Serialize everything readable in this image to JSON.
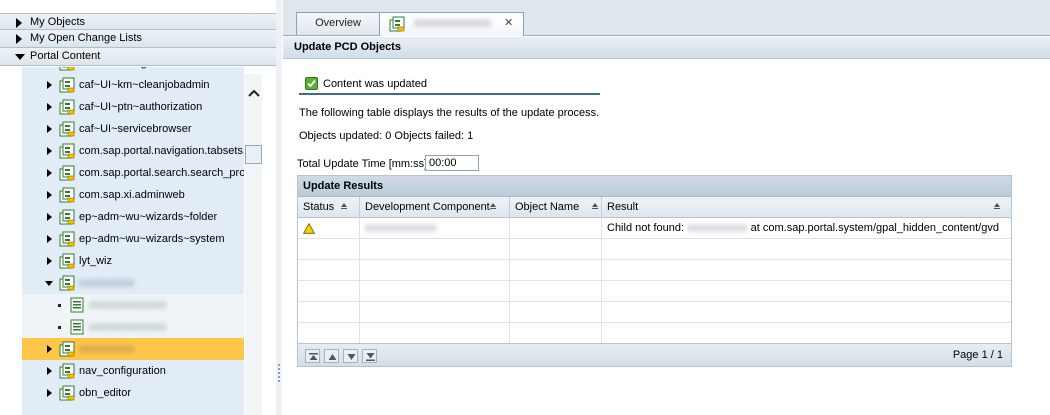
{
  "nav": {
    "sections": [
      {
        "label": "My Objects",
        "expanded": false
      },
      {
        "label": "My Open Change Lists",
        "expanded": false
      },
      {
        "label": "Portal Content",
        "expanded": true
      }
    ],
    "tree": [
      {
        "label": "caf~UI~configuration",
        "level": 0,
        "expanded": false,
        "kind": "package",
        "partial": true
      },
      {
        "label": "caf~UI~km~cleanjobadmin",
        "level": 0,
        "expanded": false,
        "kind": "package"
      },
      {
        "label": "caf~UI~ptn~authorization",
        "level": 0,
        "expanded": false,
        "kind": "package"
      },
      {
        "label": "caf~UI~servicebrowser",
        "level": 0,
        "expanded": false,
        "kind": "package"
      },
      {
        "label": "com.sap.portal.navigation.tabsets.",
        "level": 0,
        "expanded": false,
        "kind": "package"
      },
      {
        "label": "com.sap.portal.search.search_pro",
        "level": 0,
        "expanded": false,
        "kind": "package"
      },
      {
        "label": "com.sap.xi.adminweb",
        "level": 0,
        "expanded": false,
        "kind": "package"
      },
      {
        "label": "ep~adm~wu~wizards~folder",
        "level": 0,
        "expanded": false,
        "kind": "package"
      },
      {
        "label": "ep~adm~wu~wizards~system",
        "level": 0,
        "expanded": false,
        "kind": "package"
      },
      {
        "label": "lyt_wiz",
        "level": 0,
        "expanded": false,
        "kind": "package"
      },
      {
        "label": "",
        "level": 0,
        "expanded": true,
        "kind": "package",
        "redacted": true
      },
      {
        "label": "",
        "level": 1,
        "kind": "object",
        "redacted": true
      },
      {
        "label": "",
        "level": 1,
        "kind": "object",
        "redacted": true
      },
      {
        "label": "",
        "level": 0,
        "expanded": false,
        "kind": "package",
        "redacted": true,
        "selected": true
      },
      {
        "label": "nav_configuration",
        "level": 0,
        "expanded": false,
        "kind": "package"
      },
      {
        "label": "obn_editor",
        "level": 0,
        "expanded": false,
        "kind": "package"
      }
    ]
  },
  "tabs": {
    "overview": "Overview",
    "active_close": "✕"
  },
  "panel": {
    "title": "Update PCD Objects",
    "message": "Content was updated",
    "description": "The following table displays the results of the update process.",
    "summary": "Objects updated: 0 Objects failed: 1",
    "time_label": "Total Update Time [mm:ss]",
    "time_value": "00:00"
  },
  "table": {
    "title": "Update Results",
    "columns": [
      "Status",
      "Development Component",
      "Object Name",
      "Result"
    ],
    "rows": [
      {
        "status": "warning",
        "component": "",
        "component_redacted": true,
        "object": "",
        "result_prefix": "Child not found: ",
        "result_suffix": " at com.sap.portal.system/gpal_hidden_content/gvd"
      },
      {},
      {},
      {},
      {},
      {}
    ],
    "pager": "Page 1 / 1"
  },
  "colors": {
    "selection": "#ffc64a",
    "tree_bg": "#e1ecf6",
    "warning": "#f5d300"
  }
}
